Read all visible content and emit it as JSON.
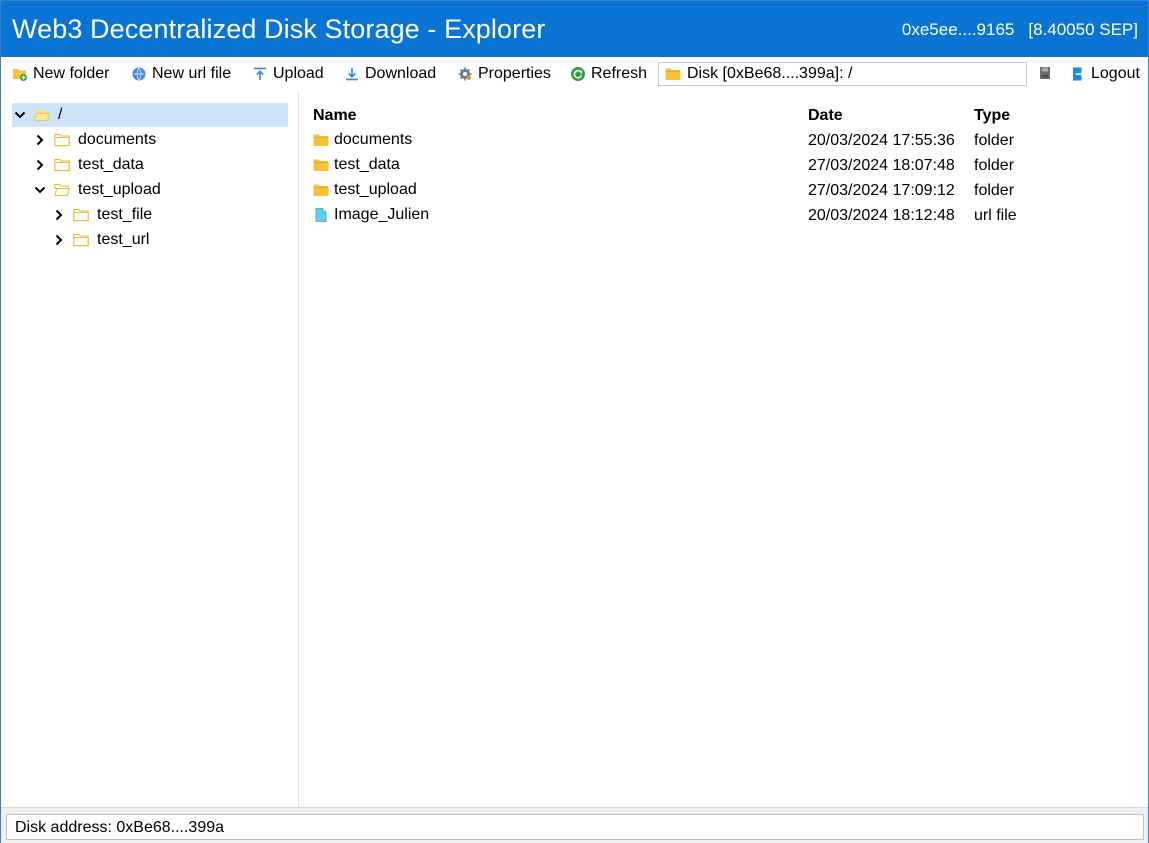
{
  "titlebar": {
    "title": "Web3 Decentralized Disk Storage - Explorer",
    "account": "0xe5ee....9165",
    "balance": "[8.40050 SEP]"
  },
  "toolbar": {
    "new_folder": "New folder",
    "new_url_file": "New url file",
    "upload": "Upload",
    "download": "Download",
    "properties": "Properties",
    "refresh": "Refresh",
    "path": "Disk [0xBe68....399a]: /",
    "logout": "Logout"
  },
  "tree": {
    "root": "/",
    "items": [
      {
        "label": "documents"
      },
      {
        "label": "test_data"
      },
      {
        "label": "test_upload"
      },
      {
        "label": "test_file"
      },
      {
        "label": "test_url"
      }
    ]
  },
  "list": {
    "columns": {
      "name": "Name",
      "date": "Date",
      "type": "Type"
    },
    "rows": [
      {
        "name": "documents",
        "date": "20/03/2024 17:55:36",
        "type": "folder",
        "icon": "folder-icon"
      },
      {
        "name": "test_data",
        "date": "27/03/2024 18:07:48",
        "type": "folder",
        "icon": "folder-icon"
      },
      {
        "name": "test_upload",
        "date": "27/03/2024 17:09:12",
        "type": "folder",
        "icon": "folder-icon"
      },
      {
        "name": "Image_Julien",
        "date": "20/03/2024 18:12:48",
        "type": "url file",
        "icon": "url-file-icon"
      }
    ]
  },
  "statusbar": {
    "text": "Disk address: 0xBe68....399a"
  },
  "colors": {
    "titlebar": "#0a74d4",
    "selection": "#cce4f7",
    "folder": "#f6c33b"
  }
}
